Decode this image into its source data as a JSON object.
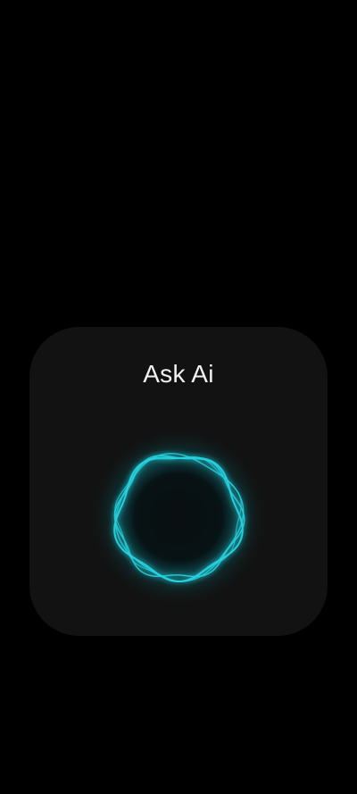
{
  "assistant_card": {
    "title": "Ask Ai",
    "orb_icon": "voice-waveform-ring-icon",
    "accent_color": "#27d3e0"
  },
  "colors": {
    "background": "#000000",
    "card": "#121212",
    "title_text": "#f2f2f2"
  }
}
